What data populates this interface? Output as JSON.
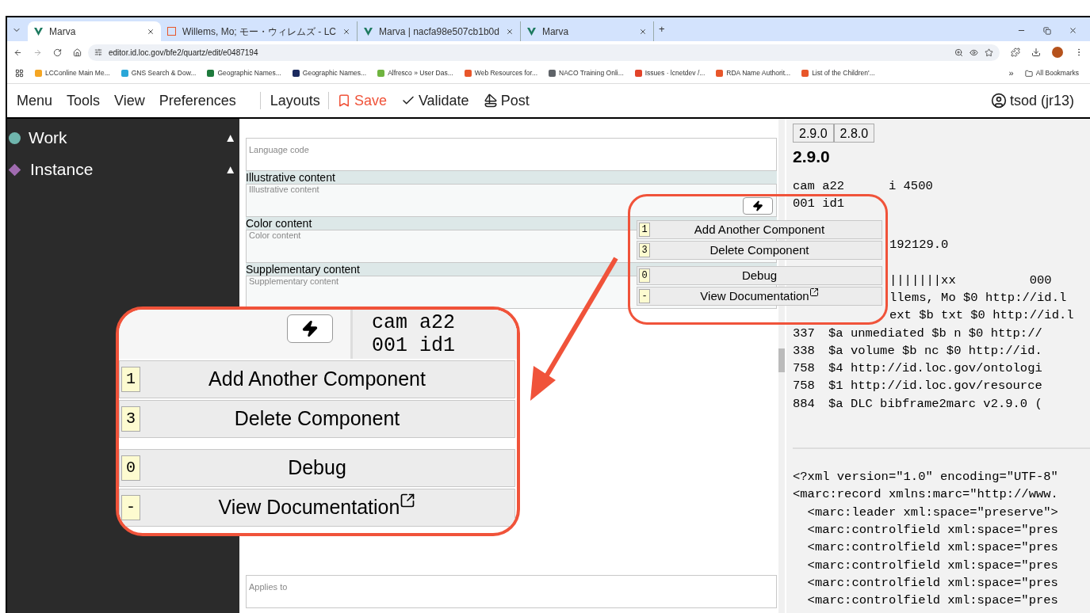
{
  "browser": {
    "tabs": [
      {
        "title": "Marva",
        "selected": true
      },
      {
        "title": "Willems, Mo; モー・ウィレムズ - LC",
        "selected": false
      },
      {
        "title": "Marva | nacfa98e507cb1b0d",
        "selected": false
      },
      {
        "title": "Marva",
        "selected": false
      }
    ],
    "new_tab": "+",
    "url": "editor.id.loc.gov/bfe2/quartz/edit/e0487194",
    "bookmarks": [
      {
        "label": "LCConline Main Me...",
        "color": "#f5a623"
      },
      {
        "label": "GNS Search & Dow...",
        "color": "#2aa7d8"
      },
      {
        "label": "Geographic Names...",
        "color": "#1e7a3c"
      },
      {
        "label": "Geographic Names...",
        "color": "#1b2a5e"
      },
      {
        "label": "Alfresco » User Das...",
        "color": "#6fb43f"
      },
      {
        "label": "Web Resources for...",
        "color": "#e8562a"
      },
      {
        "label": "NACO Training Onli...",
        "color": "#5f6368"
      },
      {
        "label": "Issues · lcnetdev /...",
        "color": "#e24329"
      },
      {
        "label": "RDA Name Authorit...",
        "color": "#e8562a"
      },
      {
        "label": "List of the Children'...",
        "color": "#e8562a"
      }
    ],
    "more": "»",
    "all_bookmarks": "All Bookmarks"
  },
  "toolbar": {
    "items": [
      {
        "label": "Menu",
        "kind": "plain"
      },
      {
        "label": "Tools",
        "kind": "plain"
      },
      {
        "label": "View",
        "kind": "plain"
      },
      {
        "label": "Preferences",
        "kind": "plain"
      },
      {
        "label": "Layouts",
        "kind": "separated"
      },
      {
        "label": "Save",
        "kind": "save"
      },
      {
        "label": "Validate",
        "kind": "validate"
      },
      {
        "label": "Post",
        "kind": "post"
      }
    ],
    "user": "tsod (jr13)"
  },
  "sidebar": {
    "items": [
      {
        "label": "Work",
        "kind": "circle",
        "color": "#6fb5ad",
        "toggle": "▲"
      },
      {
        "label": "Instance",
        "kind": "diamond",
        "color": "#a06bb0",
        "toggle": "▲"
      }
    ]
  },
  "form": {
    "rows": [
      {
        "placeholder": "Language code"
      },
      {
        "heading": "Illustrative content",
        "placeholder": "Illustrative content"
      },
      {
        "heading": "Color content",
        "placeholder": "Color content"
      },
      {
        "heading": "Supplementary content",
        "placeholder": "Supplementary content"
      },
      {
        "placeholder": "Applies to"
      }
    ]
  },
  "marc": {
    "versions": [
      "2.9.0",
      "2.8.0"
    ],
    "current": "2.9.0",
    "header": [
      "cam a22      i 4500",
      "001 id1"
    ],
    "lines": [
      {
        "text": "192129.0"
      },
      {
        "text": "|||||||xx          000"
      },
      {
        "text": "llems, Mo $0 http://id.l"
      },
      {
        "text": "ext $b txt $0 http://id.l"
      },
      {
        "tag": "337",
        "text": "$a unmediated $b n $0 http://"
      },
      {
        "tag": "338",
        "text": "$a volume $b nc $0 http://id."
      },
      {
        "tag": "758",
        "text": "$4 http://id.loc.gov/ontologi"
      },
      {
        "tag": "758",
        "text": "$1 http://id.loc.gov/resource"
      },
      {
        "tag": "884",
        "text": "$a DLC bibframe2marc v2.9.0 ("
      }
    ],
    "xml": [
      "<?xml version=\"1.0\" encoding=\"UTF-8\"",
      "<marc:record xmlns:marc=\"http://www.",
      "  <marc:leader xml:space=\"preserve\">",
      "  <marc:controlfield xml:space=\"pres",
      "  <marc:controlfield xml:space=\"pres",
      "  <marc:controlfield xml:space=\"pres",
      "  <marc:controlfield xml:space=\"pres",
      "  <marc:controlfield xml:space=\"pres"
    ]
  },
  "menu": {
    "items": [
      {
        "key": "1",
        "label": "Add Another Component",
        "external": false
      },
      {
        "key": "3",
        "label": "Delete Component",
        "external": false
      },
      {
        "key": "0",
        "label": "Debug",
        "external": false
      },
      {
        "key": "-",
        "label": "View Documentation",
        "external": true
      }
    ]
  },
  "callout": {
    "snippet": [
      "cam a22",
      "001 id1"
    ],
    "items": [
      {
        "key": "1",
        "label": "Add Another Component",
        "external": false
      },
      {
        "key": "3",
        "label": "Delete Component",
        "external": false
      },
      {
        "key": "0",
        "label": "Debug",
        "external": false
      },
      {
        "key": "-",
        "label": "View Documentation",
        "external": true
      }
    ]
  }
}
